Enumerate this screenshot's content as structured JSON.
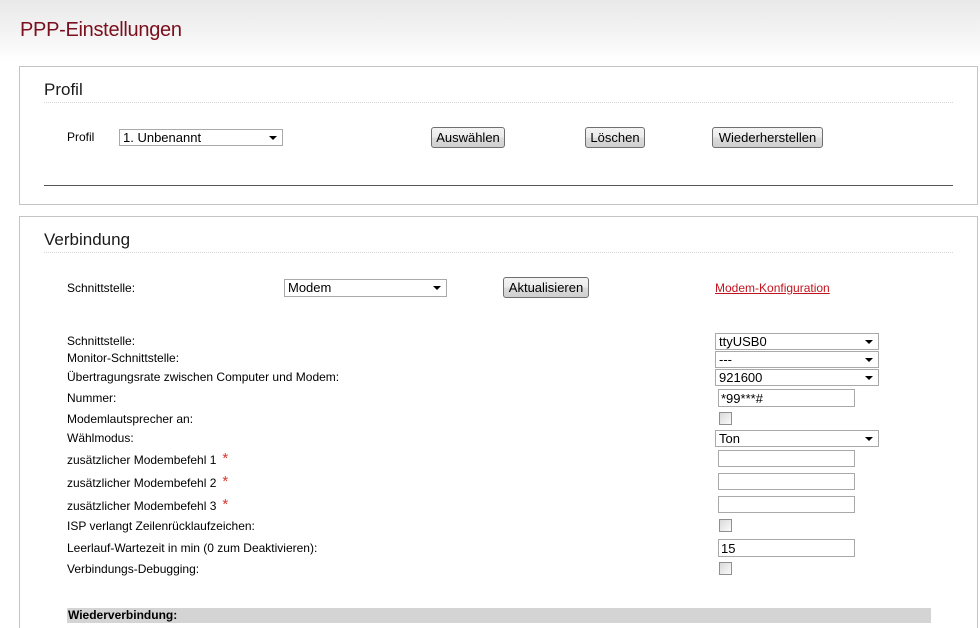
{
  "page": {
    "title": "PPP-Einstellungen"
  },
  "profil": {
    "heading": "Profil",
    "profile_label": "Profil",
    "profile_select": {
      "value": "1. Unbenannt"
    },
    "buttons": {
      "select": "Auswählen",
      "delete": "Löschen",
      "restore": "Wiederherstellen"
    }
  },
  "verbindung": {
    "heading": "Verbindung",
    "interface_label": "Schnittstelle:",
    "interface_select": {
      "value": "Modem"
    },
    "refresh_button": "Aktualisieren",
    "modem_config_link": "Modem-Konfiguration",
    "fields": [
      {
        "label": "Schnittstelle:",
        "value": "ttyUSB0"
      },
      {
        "label": "Monitor-Schnittstelle:",
        "value": "---"
      },
      {
        "label": "Übertragungsrate zwischen Computer und Modem:",
        "value": "921600"
      },
      {
        "label": "Nummer:",
        "value": "*99***#"
      },
      {
        "label": "Modemlautsprecher an:",
        "checked": false
      },
      {
        "label": "Wählmodus:",
        "value": "Ton"
      },
      {
        "label": "zusätzlicher Modembefehl 1",
        "value": "",
        "required_mark": "*"
      },
      {
        "label": "zusätzlicher Modembefehl 2",
        "value": "",
        "required_mark": "*"
      },
      {
        "label": "zusätzlicher Modembefehl 3",
        "value": "",
        "required_mark": "*"
      },
      {
        "label": "ISP verlangt Zeilenrücklaufzeichen:",
        "checked": false
      },
      {
        "label": "Leerlauf-Wartezeit in min (0 zum Deaktivieren):",
        "value": "15"
      },
      {
        "label": "Verbindungs-Debugging:",
        "checked": false
      }
    ]
  },
  "reconnect": {
    "heading": "Wiederverbindung:"
  },
  "icons": {
    "dropdown": "chevron-down-icon",
    "required": "asterisk-icon"
  },
  "colors": {
    "title": "#7a0f1d",
    "link": "#c0141e",
    "required_mark": "#e0352b",
    "section_border": "#c4c4c4",
    "subheader_bar": "#d4d4d4"
  }
}
